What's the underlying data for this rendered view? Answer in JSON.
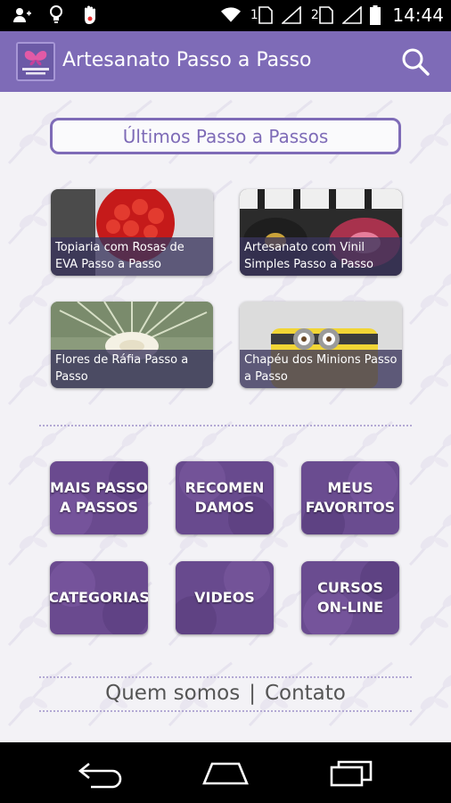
{
  "status_bar": {
    "time": "14:44",
    "sim1_label": "1",
    "sim2_label": "2",
    "icons": [
      "person-add-icon",
      "lightbulb-icon",
      "hand-icon",
      "wifi-icon",
      "sim-card-icon",
      "signal-icon",
      "battery-icon"
    ]
  },
  "app_bar": {
    "title": "Artesanato Passo a Passo",
    "logo_text": "ARTESANATO PASSO A PASSO",
    "search_icon": "search-icon",
    "color": "#7e6bb7"
  },
  "latest": {
    "heading": "Últimos Passo a Passos",
    "cards": [
      {
        "caption": "Topiaria com Rosas de EVA Passo a Passo"
      },
      {
        "caption": "Artesanato com Vinil Simples Passo a Passo"
      },
      {
        "caption": "Flores de Ráfia Passo a Passo"
      },
      {
        "caption": "Chapéu dos Minions Passo a Passo"
      }
    ]
  },
  "menu": {
    "tiles": [
      {
        "label": "MAIS PASSO A PASSOS"
      },
      {
        "label": "RECOMEN DAMOS"
      },
      {
        "label": "MEUS FAVORITOS"
      },
      {
        "label": "CATEGORIAS"
      },
      {
        "label": "VIDEOS"
      },
      {
        "label": "CURSOS ON-LINE"
      }
    ]
  },
  "footer": {
    "about": "Quem somos",
    "separator": "|",
    "contact": "Contato"
  },
  "nav_bar": {
    "icons": [
      "back-icon",
      "home-icon",
      "recent-apps-icon"
    ]
  }
}
